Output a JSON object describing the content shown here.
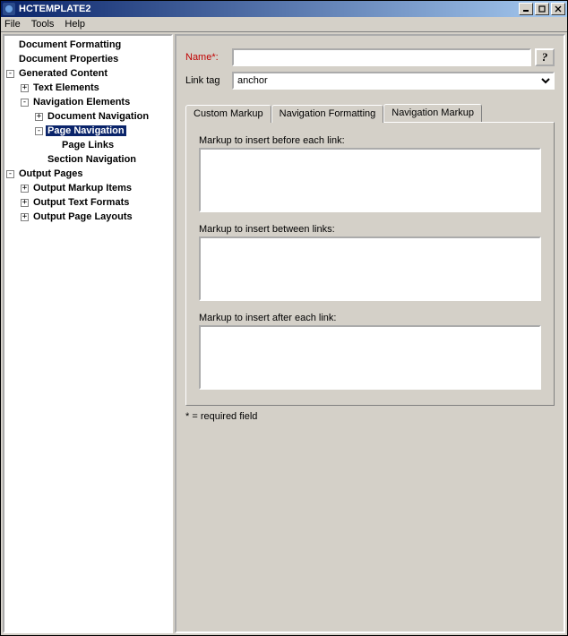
{
  "window": {
    "title": "HCTEMPLATE2"
  },
  "menu": {
    "file": "File",
    "tools": "Tools",
    "help": "Help"
  },
  "tree": {
    "docFormatting": "Document Formatting",
    "docProperties": "Document Properties",
    "genContent": "Generated Content",
    "textElements": "Text Elements",
    "navElements": "Navigation Elements",
    "docNav": "Document Navigation",
    "pageNav": "Page Navigation",
    "pageLinks": "Page Links",
    "sectionNav": "Section Navigation",
    "outputPages": "Output Pages",
    "outMarkup": "Output Markup Items",
    "outText": "Output Text Formats",
    "outLayouts": "Output Page Layouts"
  },
  "form": {
    "nameLabel": "Name*:",
    "nameValue": "",
    "linkTagLabel": "Link tag",
    "linkTagValue": "anchor",
    "helpGlyph": "?"
  },
  "tabs": {
    "custom": "Custom Markup",
    "navFmt": "Navigation Formatting",
    "navMarkup": "Navigation Markup"
  },
  "panel": {
    "beforeLabel": "Markup to insert before each link:",
    "betweenLabel": "Markup to insert between links:",
    "afterLabel": "Markup to insert after each link:",
    "beforeValue": "",
    "betweenValue": "",
    "afterValue": ""
  },
  "footnote": "* = required field"
}
